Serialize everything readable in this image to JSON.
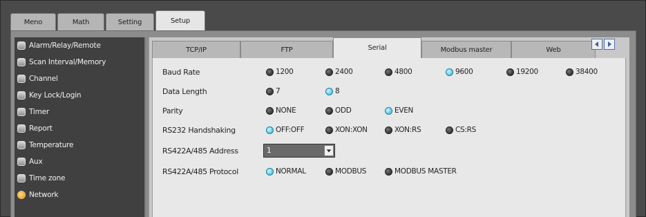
{
  "top_tabs": [
    "Meno",
    "Math",
    "Setting",
    "Setup"
  ],
  "sidebar": {
    "items": [
      {
        "label": "Alarm/Relay/Remote",
        "icon": "square-icon"
      },
      {
        "label": "Scan Interval/Memory",
        "icon": "square-icon"
      },
      {
        "label": "Channel",
        "icon": "square-icon"
      },
      {
        "label": "Key Lock/Login",
        "icon": "square-icon"
      },
      {
        "label": "Timer",
        "icon": "square-icon"
      },
      {
        "label": "Report",
        "icon": "square-icon"
      },
      {
        "label": "Temperature",
        "icon": "square-icon"
      },
      {
        "label": "Aux",
        "icon": "square-icon"
      },
      {
        "label": "Time zone",
        "icon": "square-icon"
      },
      {
        "label": "Network",
        "icon": "orange-dot-icon",
        "selected": true
      }
    ]
  },
  "sub_tabs": [
    "TCP/IP",
    "FTP",
    "Serial",
    "Modbus master",
    "Web"
  ],
  "active_sub_tab": "Serial",
  "form": {
    "baud_rate": {
      "label": "Baud Rate",
      "options": [
        "1200",
        "2400",
        "4800",
        "9600",
        "19200",
        "38400"
      ],
      "selected": "9600"
    },
    "data_length": {
      "label": "Data Length",
      "options": [
        "7",
        "8"
      ],
      "selected": "8"
    },
    "parity": {
      "label": "Parity",
      "options": [
        "NONE",
        "ODD",
        "EVEN"
      ],
      "selected": "EVEN"
    },
    "handshaking": {
      "label": "RS232 Handshaking",
      "options": [
        "OFF:OFF",
        "XON:XON",
        "XON:RS",
        "CS:RS"
      ],
      "selected": "OFF:OFF"
    },
    "address": {
      "label": "RS422A/485 Address",
      "value": "1"
    },
    "protocol": {
      "label": "RS422A/485 Protocol",
      "options": [
        "NORMAL",
        "MODBUS",
        "MODBUS MASTER"
      ],
      "selected": "NORMAL"
    }
  },
  "colors": {
    "selected_radio": "#2fb0d8",
    "unselected_radio": "#1b1b1b",
    "network_icon": "#e9901a"
  }
}
